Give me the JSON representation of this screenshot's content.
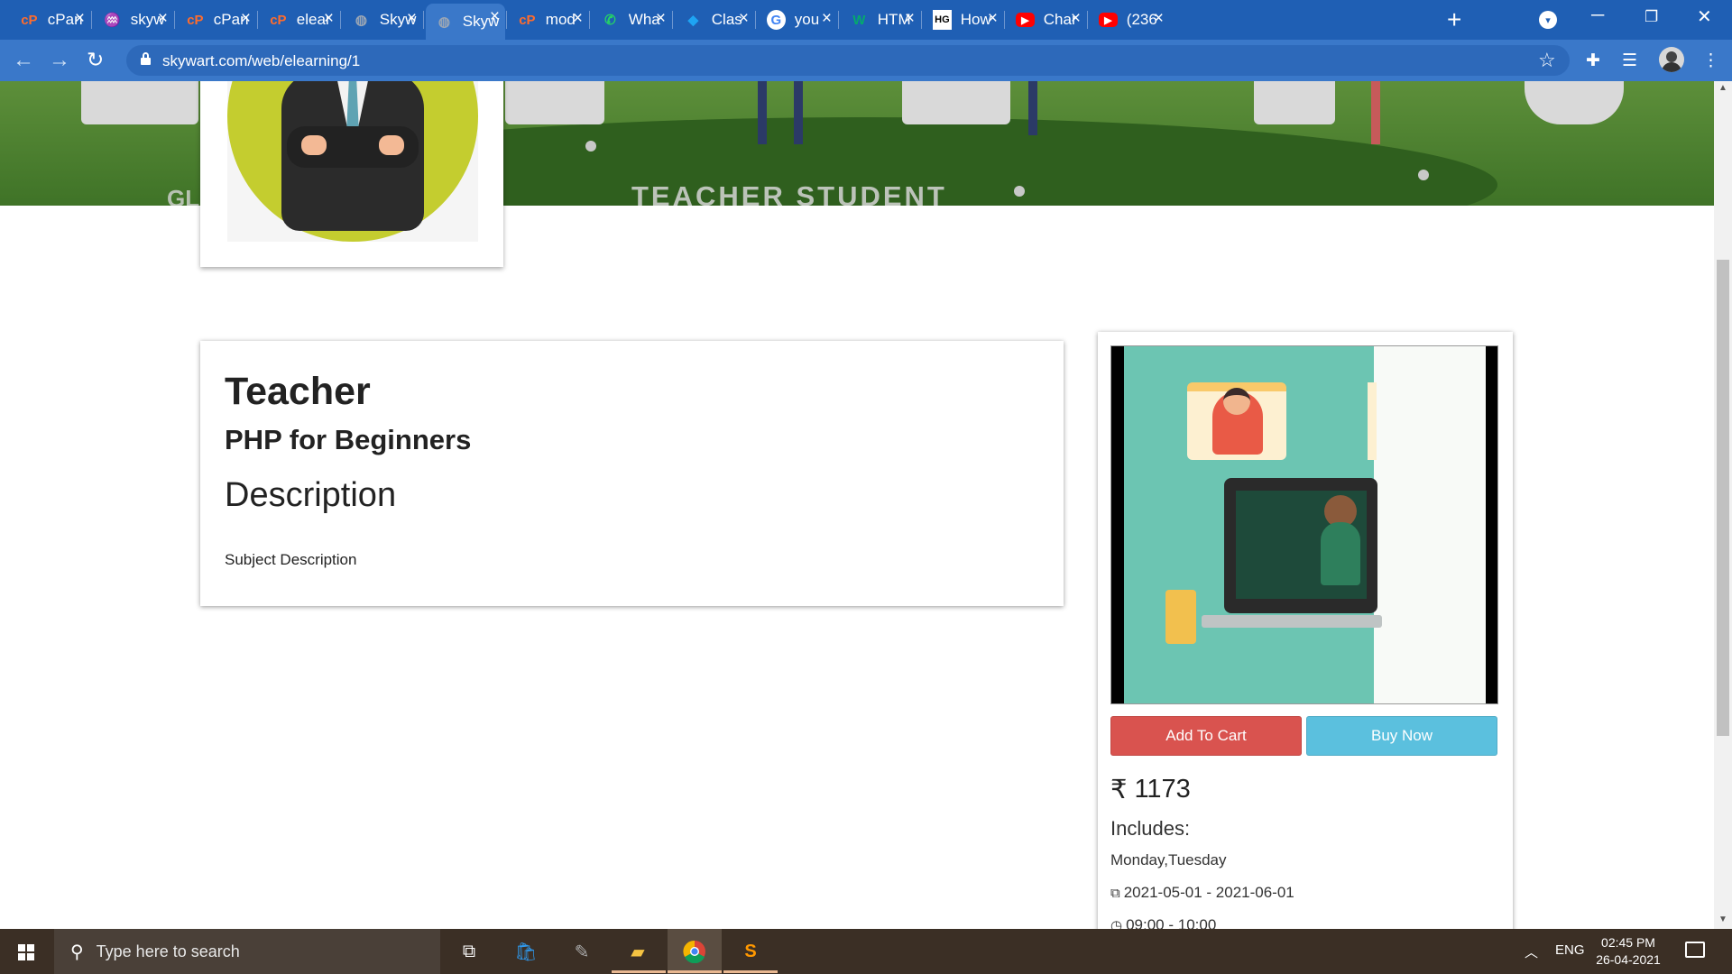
{
  "browser": {
    "tabs": [
      {
        "label": "cPan",
        "favicon": "cpanel-icon",
        "color": "#ff6c2c"
      },
      {
        "label": "skyw",
        "favicon": "skyw-logo-icon",
        "color": "#f2b400"
      },
      {
        "label": "cPan",
        "favicon": "cpanel-icon",
        "color": "#ff6c2c"
      },
      {
        "label": "elear",
        "favicon": "cpanel-icon",
        "color": "#ff6c2c"
      },
      {
        "label": "Skyw",
        "favicon": "globe-icon",
        "color": "#9aa6b5"
      },
      {
        "label": "Skyw",
        "favicon": "globe-icon",
        "color": "#9aa6b5"
      },
      {
        "label": "mod",
        "favicon": "cpanel-icon",
        "color": "#ff6c2c"
      },
      {
        "label": "Wha",
        "favicon": "whatsapp-icon",
        "color": "#25d366"
      },
      {
        "label": "Clas",
        "favicon": "classroom-icon",
        "color": "#1ea4f3"
      },
      {
        "label": "you",
        "favicon": "google-icon",
        "color": "#ffffff"
      },
      {
        "label": "HTM",
        "favicon": "w3schools-icon",
        "color": "#04aa6d"
      },
      {
        "label": "How",
        "favicon": "hg-icon",
        "color": "#ffffff"
      },
      {
        "label": "Char",
        "favicon": "youtube-icon",
        "color": "#ff0000"
      },
      {
        "label": "(236",
        "favicon": "youtube-icon",
        "color": "#ff0000"
      }
    ],
    "active_tab_index": 5,
    "url": "skywart.com/web/elearning/1"
  },
  "page": {
    "banner_caption": "TEACHER STUDENT",
    "banner_caption_left": "GL",
    "teacher": {
      "role": "Teacher",
      "course": "PHP for Beginners"
    },
    "description": {
      "heading": "Description",
      "text": "Subject Description"
    },
    "purchase": {
      "add_to_cart": "Add To Cart",
      "buy_now": "Buy Now",
      "currency": "₹",
      "price": "1173",
      "includes_label": "Includes:",
      "days": "Monday,Tuesday",
      "date_range": "2021-05-01 - 2021-06-01",
      "time_range": "09:00 - 10:00"
    },
    "colors": {
      "add_to_cart": "#d9534f",
      "buy_now": "#5bc0de"
    }
  },
  "taskbar": {
    "search_placeholder": "Type here to search",
    "language": "ENG",
    "time": "02:45 PM",
    "date": "26-04-2021"
  }
}
